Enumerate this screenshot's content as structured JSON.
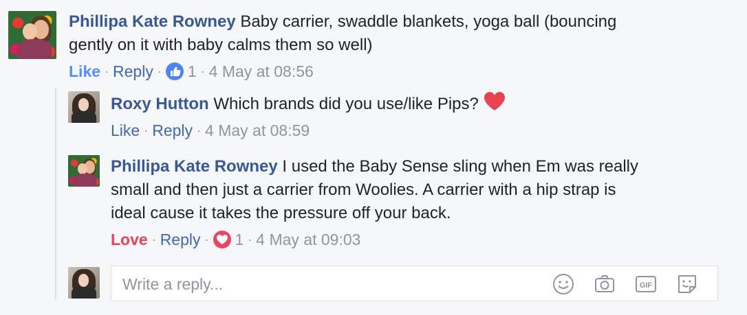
{
  "comment_main": {
    "author": "Phillipa Kate Rowney",
    "text_line1": " Baby carrier, swaddle blankets, yoga ball (bouncing",
    "text_line2": "gently on it with baby calms them so well)",
    "like_label": "Like",
    "reply_label": "Reply",
    "reaction_count": "1",
    "reaction_icon": "like-icon",
    "timestamp": "4 May at 08:56"
  },
  "reply_1": {
    "author": "Roxy Hutton",
    "text": " Which brands did you use/like Pips?",
    "emoji": "heart-emoji",
    "like_label": "Like",
    "reply_label": "Reply",
    "timestamp": "4 May at 08:59"
  },
  "reply_2": {
    "author": "Phillipa Kate Rowney",
    "text_line1": " I used the Baby Sense sling when Em was really",
    "text_line2": "small and then just a carrier from Woolies. A carrier with a hip strap is",
    "text_line3": "ideal cause it takes the pressure off your back.",
    "love_label": "Love",
    "reply_label": "Reply",
    "reaction_count": "1",
    "reaction_icon": "love-icon",
    "timestamp": "4 May at 09:03"
  },
  "reply_box": {
    "placeholder": "Write a reply...",
    "tools": [
      "emoji-icon",
      "camera-icon",
      "gif-icon",
      "sticker-icon"
    ],
    "gif_label": "GIF"
  },
  "separator": "·",
  "colors": {
    "name": "#365899",
    "like_active": "#598dfb",
    "love": "#f33e58",
    "meta": "#90949c",
    "link": "#4267b2"
  }
}
